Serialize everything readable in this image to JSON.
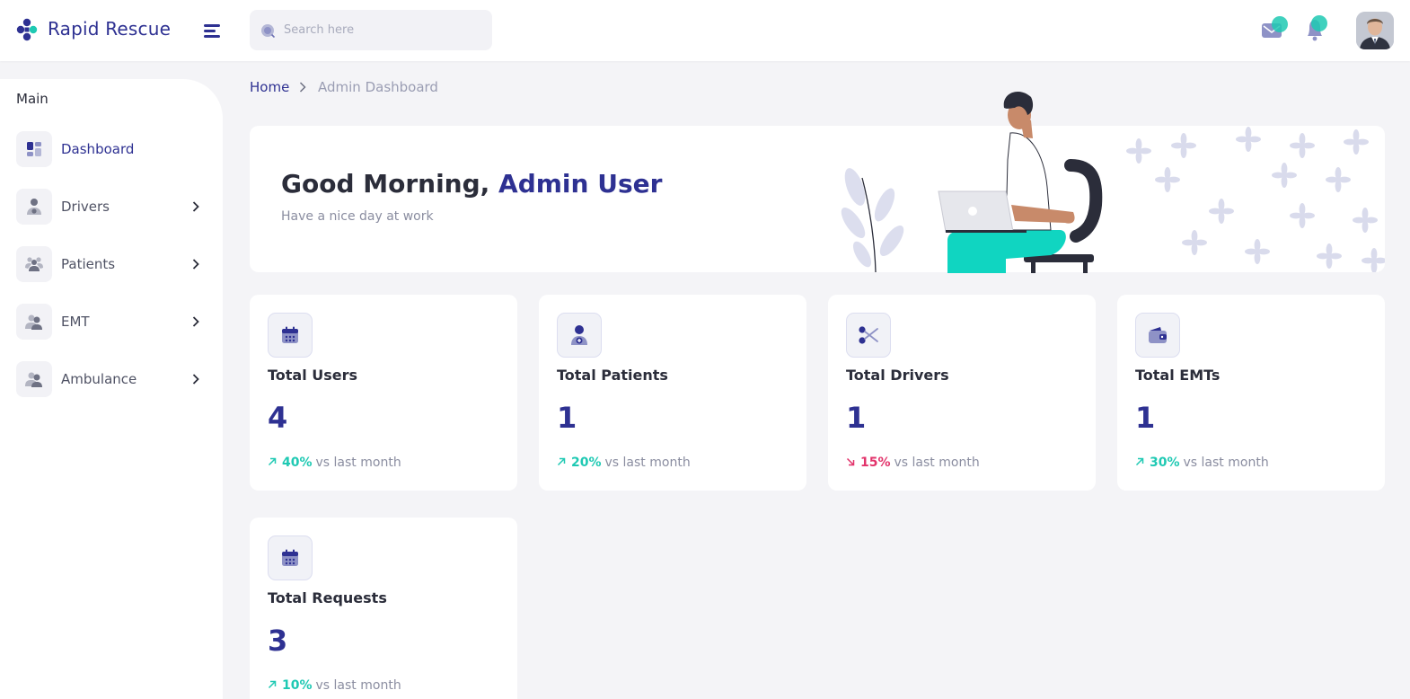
{
  "app": {
    "brand": "Rapid Rescue"
  },
  "header": {
    "search_placeholder": "Search here",
    "icons": [
      "message-icon",
      "notification-bell-icon"
    ],
    "accent": "#2e3192",
    "teal": "#1fc9b3"
  },
  "sidebar": {
    "section": "Main",
    "items": [
      {
        "label": "Dashboard",
        "icon": "dashboard-grid-icon",
        "active": true,
        "has_submenu": false
      },
      {
        "label": "Drivers",
        "icon": "driver-icon",
        "active": false,
        "has_submenu": true
      },
      {
        "label": "Patients",
        "icon": "patients-icon",
        "active": false,
        "has_submenu": true
      },
      {
        "label": "EMT",
        "icon": "emt-users-icon",
        "active": false,
        "has_submenu": true
      },
      {
        "label": "Ambulance",
        "icon": "ambulance-users-icon",
        "active": false,
        "has_submenu": true
      }
    ]
  },
  "breadcrumb": {
    "home": "Home",
    "current": "Admin Dashboard"
  },
  "welcome": {
    "greeting": "Good Morning, ",
    "name": "Admin User",
    "subtitle": "Have a nice day at work"
  },
  "stats": [
    {
      "title": "Total Users",
      "value": "4",
      "pct": "40%",
      "direction": "up",
      "suffix": "vs last month",
      "icon": "calendar-icon"
    },
    {
      "title": "Total Patients",
      "value": "1",
      "pct": "20%",
      "direction": "up",
      "suffix": "vs last month",
      "icon": "patient-add-icon"
    },
    {
      "title": "Total Drivers",
      "value": "1",
      "pct": "15%",
      "direction": "down",
      "suffix": "vs last month",
      "icon": "scissors-icon"
    },
    {
      "title": "Total EMTs",
      "value": "1",
      "pct": "30%",
      "direction": "up",
      "suffix": "vs last month",
      "icon": "wallet-icon"
    },
    {
      "title": "Total Requests",
      "value": "3",
      "pct": "10%",
      "direction": "up",
      "suffix": "vs last month",
      "icon": "calendar-icon"
    }
  ]
}
